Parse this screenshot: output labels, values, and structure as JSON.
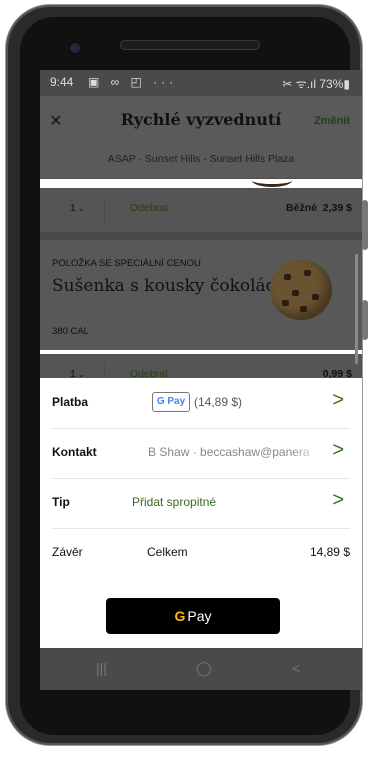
{
  "status_bar": {
    "time": "9:44",
    "left_icons": "▣ ∞ ◰ ···",
    "right_icons": "✂ ᯤ.ıl 73%▮"
  },
  "header": {
    "close_glyph": "×",
    "title": "Rychlé vyzvednutí",
    "change_label": "Změnit"
  },
  "pickup_info": "ASAP · Sunset Hills - Sunset Hills Plaza",
  "items": [
    {
      "qty": "1",
      "remove_label": "Odebrat",
      "price_tag": "Běžné",
      "price": "2,39 $"
    },
    {
      "badge": "POLOŽKA SE SPECIÁLNÍ CENOU",
      "name": "Sušenka s kousky čokolády",
      "calories": "380 CAL",
      "qty": "1",
      "remove_label": "Odebrat",
      "price": "0,99 $"
    }
  ],
  "checkout": {
    "payment": {
      "label": "Platba",
      "gpay_label": "G Pay",
      "amount": "(14,89 $)"
    },
    "contact": {
      "label": "Kontakt",
      "value": "B Shaw · beccashaw@panera"
    },
    "tip": {
      "label": "Tip",
      "value": "Přidat spropitné"
    },
    "summary": {
      "label": "Závěr",
      "total_label": "Celkem",
      "total_value": "14,89 $"
    },
    "pay_button": {
      "g": "G",
      "label": "Pay"
    },
    "arrow_glyph": ">"
  },
  "nav": {
    "recents": "|||",
    "home": "◯",
    "back": "<"
  }
}
